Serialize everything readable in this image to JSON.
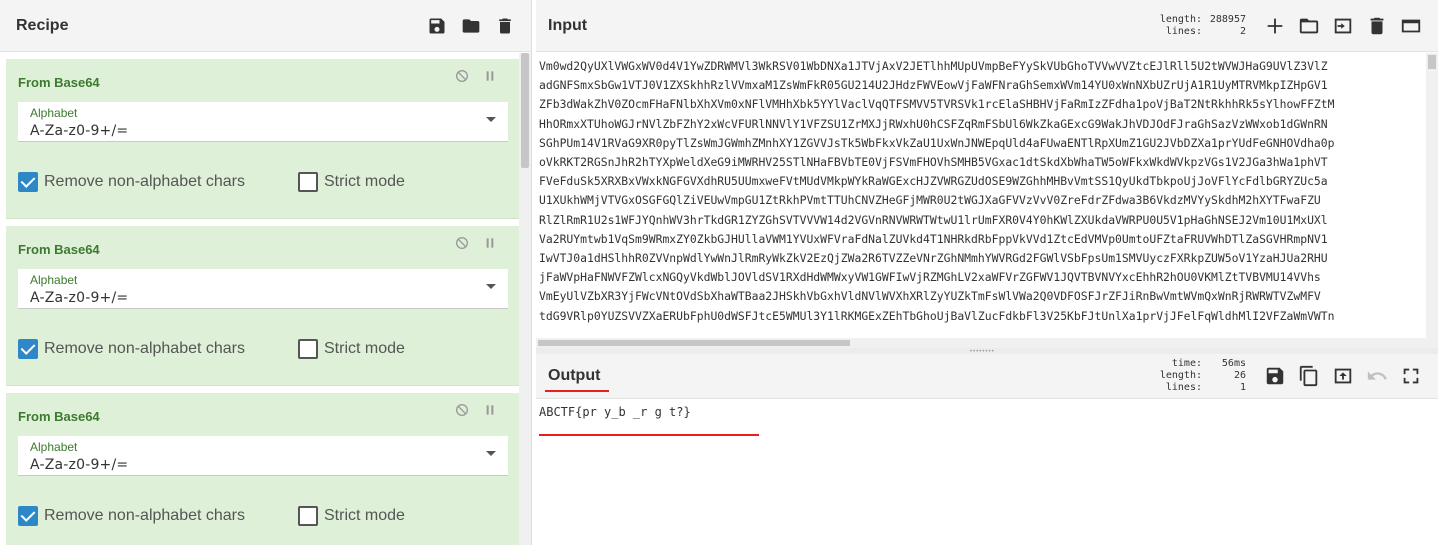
{
  "recipe": {
    "title": "Recipe",
    "operations": [
      {
        "name": "From Base64",
        "alphabet_label": "Alphabet",
        "alphabet_value": "A-Za-z0-9+/=",
        "remove_non_alphabet_label": "Remove non-alphabet chars",
        "remove_non_alphabet_checked": true,
        "strict_mode_label": "Strict mode",
        "strict_mode_checked": false
      },
      {
        "name": "From Base64",
        "alphabet_label": "Alphabet",
        "alphabet_value": "A-Za-z0-9+/=",
        "remove_non_alphabet_label": "Remove non-alphabet chars",
        "remove_non_alphabet_checked": true,
        "strict_mode_label": "Strict mode",
        "strict_mode_checked": false
      },
      {
        "name": "From Base64",
        "alphabet_label": "Alphabet",
        "alphabet_value": "A-Za-z0-9+/=",
        "remove_non_alphabet_label": "Remove non-alphabet chars",
        "remove_non_alphabet_checked": true,
        "strict_mode_label": "Strict mode",
        "strict_mode_checked": false
      }
    ]
  },
  "input": {
    "title": "Input",
    "length_label": "length:",
    "length_value": "288957",
    "lines_label": "lines:",
    "lines_value": "2",
    "text_lines": [
      "Vm0wd2QyUXlVWGxWV0d4V1YwZDRWMVl3WkRSV01WbDNXa1JTVjAxV2JETlhhMUpUVmpBeFYySkVUbGhoTVVwVVZtcEJlRll5U2tWVWJHaG9UVlZ3VlZ",
      "adGNFSmxSbGw1VTJ0V1ZXSkhhRzlVVmxaM1ZsWmFkR05GU214U2JHdzFWVEowVjFaWFNraGhSemxWVm14YU0xWnNXbUZrUjA1R1UyMTRVMkpIZHpGV1",
      "ZFb3dWakZhV0ZOcmFHaFNlbXhXVm0xNFlVMHhXbk5YYlVaclVqQTFSMVV5TVRSVk1rcElaSHBHVjFaRmIzZFdha1poVjBaT2NtRkhhRk5sYlhowFFZtM",
      "HhORmxXTUhoWGJrNVlZbFZhY2xWcVFURlNNVlY1VFZSU1ZrMXJjRWxhU0hCSFZqRmFSbUl6WkZkaGExcG9WakJhVDJOdFJraGhSazVzWWxob1dGWnRN",
      "SGhPUm14V1RVaG9XR0pyTlZsWmJGWmhZMnhXY1ZGVVJsTk5WbFkxVkZaU1UxWnJNWEpqUld4aFUwaENTlRpXUmZ1GU2JVbDZXa1prYUdFeGNHOVdha0p",
      "oVkRKT2RGSnJhR2hTYXpWeldXeG9iMWRHV25STlNHaFBVbTE0VjFSVmFHOVhSMHB5VGxac1dtSkdXbWhaTW5oWFkxWkdWVkpzVGs1V2JGa3hWa1phVT",
      "FVeFduSk5XRXBxVWxkNGFGVXdhRU5UUmxweFVtMUdVMkpWYkRaWGExcHJZVWRGZUdOSE9WZGhhMHBvVmtSS1QyUkdTbkpoUjJoVFlYcFdlbGRYZUc5a",
      "U1XUkhWMjVTVGxOSGFGQlZiVEUwVmpGU1ZtRkhPVmtTTUhCNVZHeGFjMWR0U2tWGJXaGFVVzVvV0ZreFdrZFdwa3B6VkdzMVYySkdhM2hXYTFwaFZU",
      "RlZlRmR1U2s1WFJYQnhWV3hrTkdGR1ZYZGhSVTVVVW14d2VGVnRNVWRWTWtwU1lrUmFXR0V4Y0hKWlZXUkdaVWRPU0U5V1pHaGhNSEJ2Vm10U1MxUXl",
      "Va2RUYmtwb1VqSm9WRmxZY0ZkbGJHUllaVWM1YVUxWFVraFdNalZUVkd4T1NHRkdRbFppVkVVd1ZtcEdVMVp0UmtoUFZtaFRUVWhDTlZaSGVHRmpNV1",
      "IwVTJ0a1dHSlhhR0ZVVnpWdlYwWnJlRmRyWkZkV2EzQjZWa2R6TVZZeVNrZGhNMmhYWVRGd2FGWlVSbFpsUm1SMVUyczFXRkpZUW5oV1YzaHJUa2RHU",
      "jFaWVpHaFNWVFZWlcxNGQyVkdWblJOVldSV1RXdHdWMWxyVW1GWFIwVjRZMGhLV2xaWFVrZGFWV1JQVTBVNVYxcEhhR2hOU0VKMlZtTVBVMU14VVhs",
      "VmEyUlVZbXR3YjFWcVNtOVdSbXhaWTBaa2JHSkhVbGxhVldNVlWVXhXRlZyYUZkTmFsWlVWa2Q0VDFOSFJrZFJiRnBwVmtWVmQxWnRjRWRWTVZwMFV",
      "tdG9VRlp0YUZSVVZXaERUbFphU0dWSFJtcE5WMUl3Y1lRKMGExZEhTbGhoUjBaVlZucFdkbFl3V25KbFJtUnlXa1prVjJFelFqWldhMlI2VFZaWmVWTn"
    ]
  },
  "output": {
    "title": "Output",
    "time_label": "time:",
    "time_value": "56ms",
    "length_label": "length:",
    "length_value": "26",
    "lines_label": "lines:",
    "lines_value": "1",
    "text": "ABCTF{pr    y_b    _r  g  t?}"
  }
}
